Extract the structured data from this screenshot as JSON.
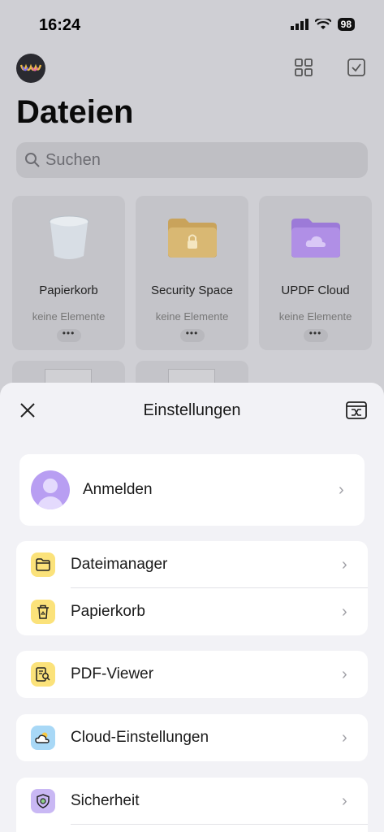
{
  "status_bar": {
    "time": "16:24",
    "battery": "98"
  },
  "page": {
    "title": "Dateien",
    "search_placeholder": "Suchen"
  },
  "cards": [
    {
      "name": "Papierkorb",
      "sub": "keine Elemente",
      "more": "•••",
      "icon": "trash-icon"
    },
    {
      "name": "Security Space",
      "sub": "keine Elemente",
      "more": "•••",
      "icon": "lock-folder-icon"
    },
    {
      "name": "UPDF Cloud",
      "sub": "keine Elemente",
      "more": "•••",
      "icon": "cloud-folder-icon"
    }
  ],
  "settings": {
    "title": "Einstellungen",
    "login_label": "Anmelden",
    "group1": [
      {
        "label": "Dateimanager",
        "icon": "folder-icon",
        "color": "#fbe27a"
      },
      {
        "label": "Papierkorb",
        "icon": "trash-icon",
        "color": "#fbe27a"
      }
    ],
    "pdf_viewer": {
      "label": "PDF-Viewer",
      "icon": "pdf-viewer-icon",
      "color": "#fbe27a"
    },
    "cloud": {
      "label": "Cloud-Einstellungen",
      "icon": "cloud-sun-icon",
      "color": "#a8d8f6"
    },
    "security": {
      "label": "Sicherheit",
      "icon": "shield-icon",
      "color": "#c9b8f4"
    }
  },
  "colors": {
    "accent_purple": "#b89ef2",
    "folder_yellow": "#fbe27a"
  }
}
